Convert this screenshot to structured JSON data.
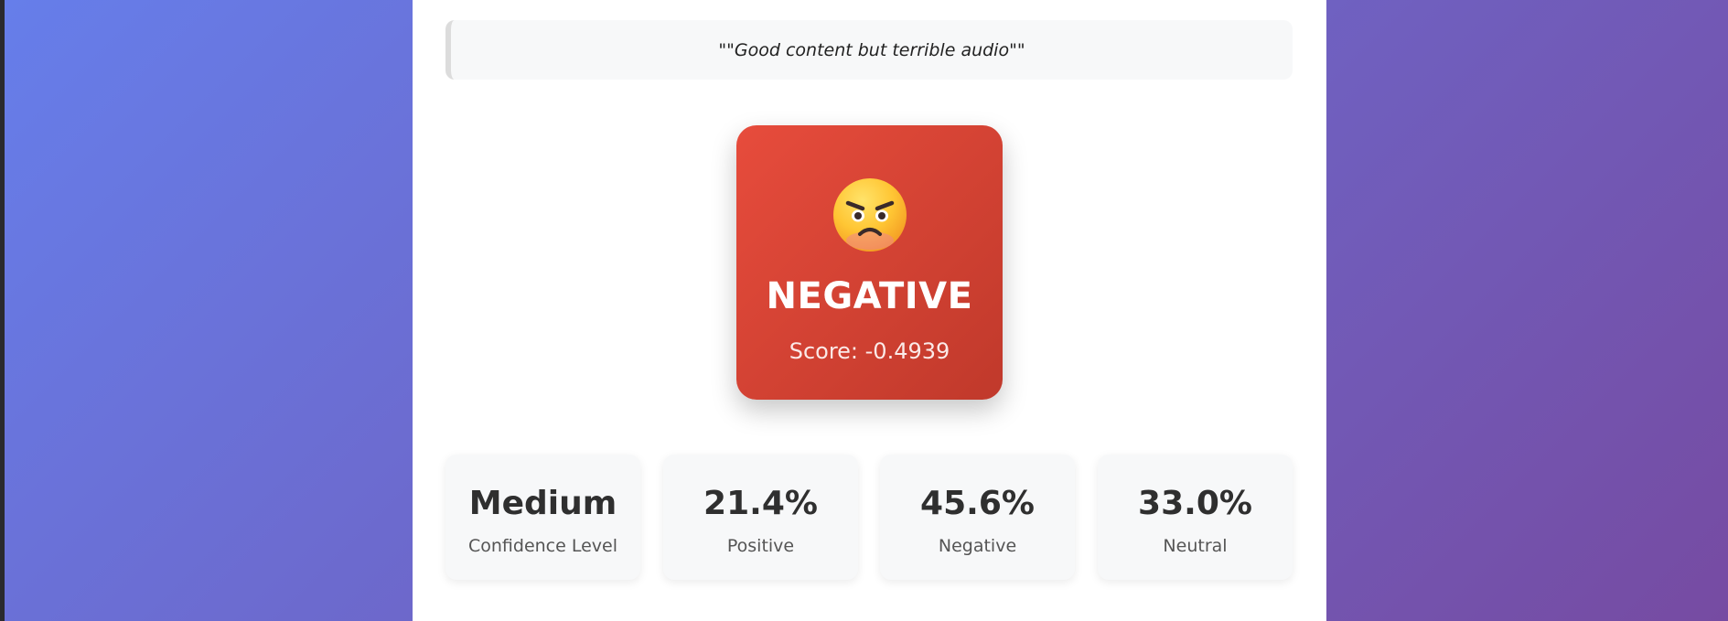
{
  "input": {
    "quote_text": "\"\"Good content but terrible audio\"\""
  },
  "sentiment": {
    "icon": "angry-face-icon",
    "label": "NEGATIVE",
    "score_text": "Score: -0.4939",
    "color": "#e74c3c"
  },
  "stats": [
    {
      "value": "Medium",
      "label": "Confidence Level"
    },
    {
      "value": "21.4%",
      "label": "Positive"
    },
    {
      "value": "45.6%",
      "label": "Negative"
    },
    {
      "value": "33.0%",
      "label": "Neutral"
    }
  ],
  "colors": {
    "background_gradient_start": "#667eea",
    "background_gradient_end": "#764ba2",
    "negative_gradient_end": "#c0392b"
  }
}
